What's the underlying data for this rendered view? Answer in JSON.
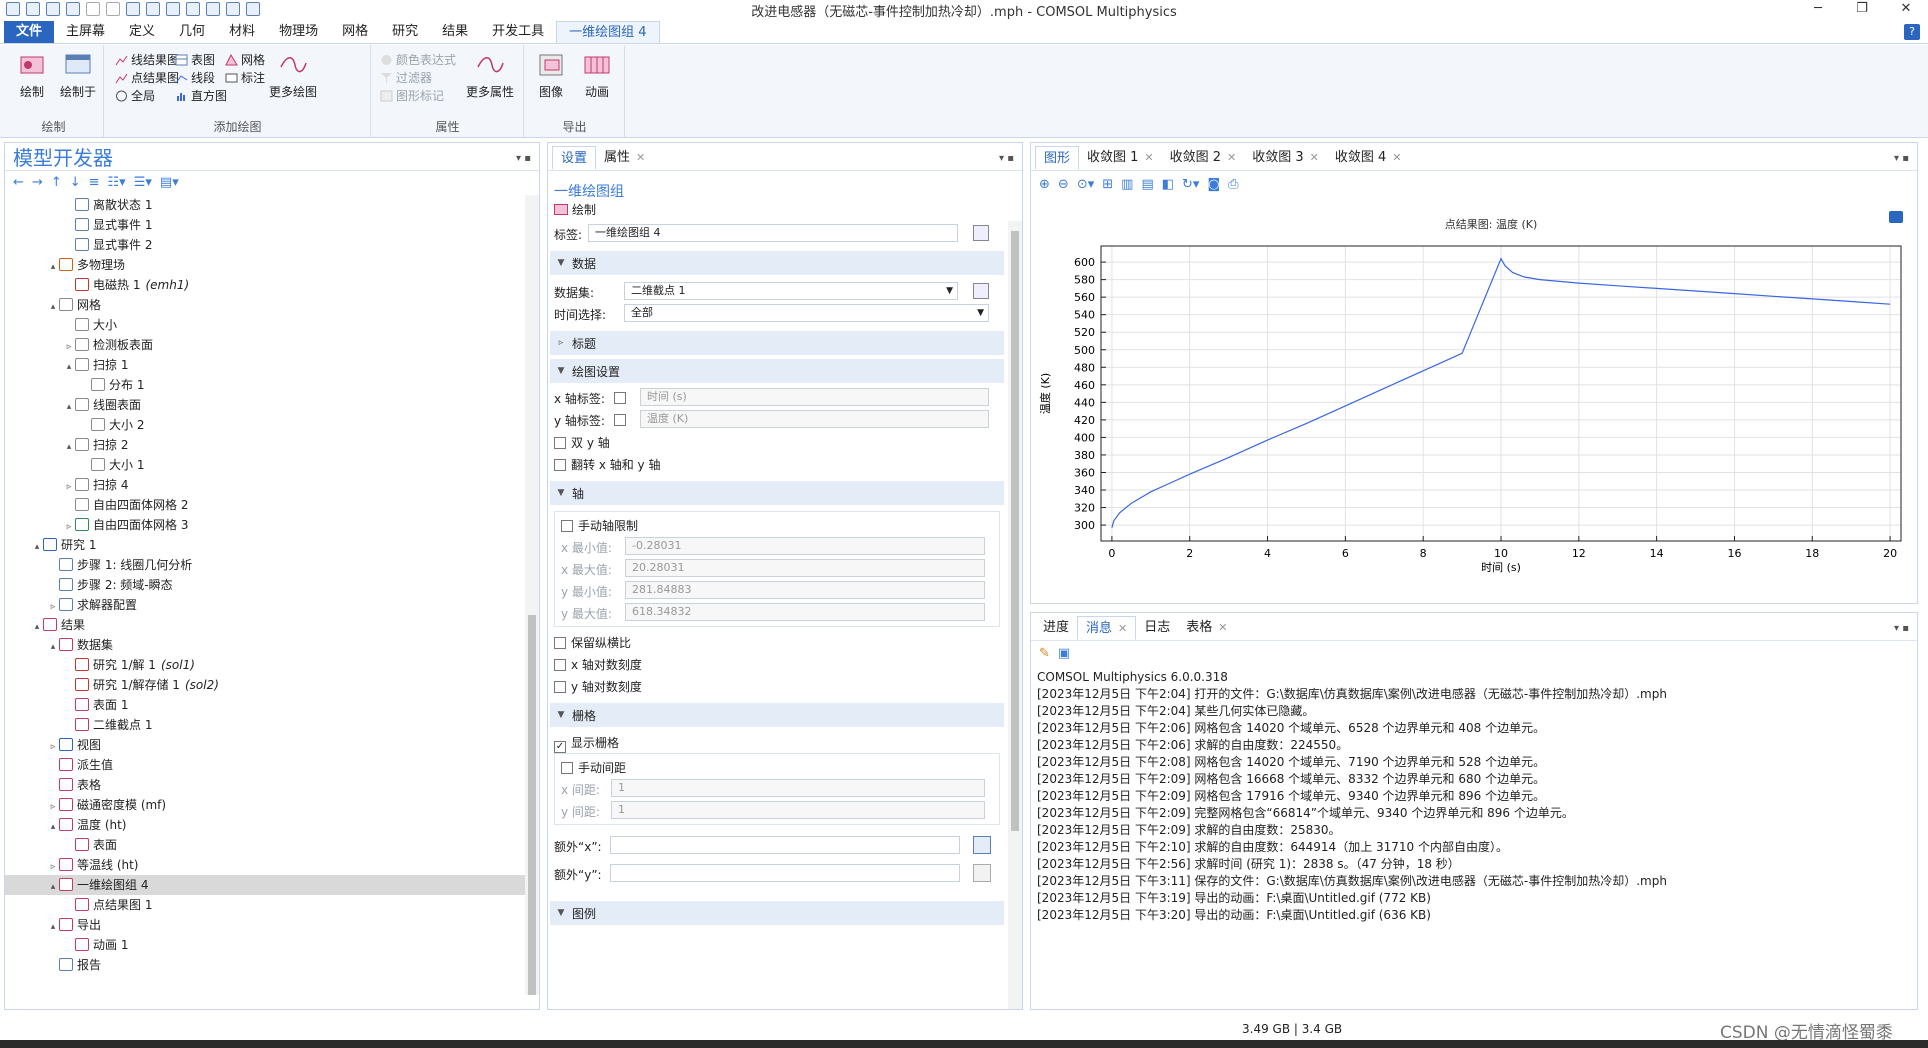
{
  "window": {
    "title": "改进电感器（无磁芯-事件控制加热冷却）.mph - COMSOL Multiphysics",
    "min": "─",
    "max": "❐",
    "close": "✕"
  },
  "menus": [
    "文件",
    "主屏幕",
    "定义",
    "几何",
    "材料",
    "物理场",
    "网格",
    "研究",
    "结果",
    "开发工具",
    "一维绘图组 4"
  ],
  "help": "?",
  "ribbon": {
    "plot_group": {
      "name": "绘制",
      "plot": "绘制",
      "plot_in": "绘制于"
    },
    "add_plot_group": {
      "name": "添加绘图",
      "items": [
        "线结果图",
        "点结果图",
        "全局",
        "表图",
        "线段",
        "直方图",
        "网格",
        "标注"
      ],
      "more": "更多绘图"
    },
    "attributes_group": {
      "name": "属性",
      "items": [
        "颜色表达式",
        "过滤器",
        "图形标记"
      ],
      "more": "更多属性"
    },
    "export_group": {
      "name": "导出",
      "image": "图像",
      "animation": "动画"
    }
  },
  "model_builder": {
    "title": "模型开发器",
    "tree": [
      {
        "label": "离散状态 1",
        "indent": 4,
        "toggle": "",
        "icon": "blue"
      },
      {
        "label": "显式事件 1",
        "indent": 4,
        "toggle": "",
        "icon": "blue"
      },
      {
        "label": "显式事件 2",
        "indent": 4,
        "toggle": "",
        "icon": "blue"
      },
      {
        "label": "多物理场",
        "indent": 3,
        "toggle": "▴",
        "icon": "multi"
      },
      {
        "label": "电磁热 1",
        "tag": "(emh1)",
        "indent": 4,
        "toggle": "",
        "icon": "red"
      },
      {
        "label": "网格",
        "indent": 3,
        "toggle": "▴",
        "icon": "mesh"
      },
      {
        "label": "大小",
        "indent": 4,
        "toggle": "",
        "icon": "mesh"
      },
      {
        "label": "检测板表面",
        "indent": 4,
        "toggle": "▹",
        "icon": "mesh"
      },
      {
        "label": "扫掠 1",
        "indent": 4,
        "toggle": "▴",
        "icon": "mesh"
      },
      {
        "label": "分布 1",
        "indent": 5,
        "toggle": "",
        "icon": "grid"
      },
      {
        "label": "线圈表面",
        "indent": 4,
        "toggle": "▴",
        "icon": "mesh"
      },
      {
        "label": "大小 2",
        "indent": 5,
        "toggle": "",
        "icon": "mesh"
      },
      {
        "label": "扫掠 2",
        "indent": 4,
        "toggle": "▴",
        "icon": "mesh"
      },
      {
        "label": "大小 1",
        "indent": 5,
        "toggle": "",
        "icon": "mesh"
      },
      {
        "label": "扫掠 4",
        "indent": 4,
        "toggle": "▹",
        "icon": "mesh"
      },
      {
        "label": "自由四面体网格 2",
        "indent": 4,
        "toggle": "",
        "icon": "mesh"
      },
      {
        "label": "自由四面体网格 3",
        "indent": 4,
        "toggle": "▹",
        "icon": "green"
      },
      {
        "label": "研究 1",
        "indent": 2,
        "toggle": "▴",
        "icon": "study"
      },
      {
        "label": "步骤 1: 线圈几何分析",
        "indent": 3,
        "toggle": "",
        "icon": "step"
      },
      {
        "label": "步骤 2: 频域-瞬态",
        "indent": 3,
        "toggle": "",
        "icon": "step"
      },
      {
        "label": "求解器配置",
        "indent": 3,
        "toggle": "▹",
        "icon": "solver"
      },
      {
        "label": "结果",
        "indent": 2,
        "toggle": "▴",
        "icon": "results"
      },
      {
        "label": "数据集",
        "indent": 3,
        "toggle": "▴",
        "icon": "dataset"
      },
      {
        "label": "研究 1/解 1",
        "tag": "(sol1)",
        "indent": 4,
        "toggle": "",
        "icon": "red"
      },
      {
        "label": "研究 1/解存储 1",
        "tag": "(sol2)",
        "indent": 4,
        "toggle": "",
        "icon": "red"
      },
      {
        "label": "表面 1",
        "indent": 4,
        "toggle": "",
        "icon": "pink"
      },
      {
        "label": "二维截点 1",
        "indent": 4,
        "toggle": "",
        "icon": "pink"
      },
      {
        "label": "视图",
        "indent": 3,
        "toggle": "▹",
        "icon": "view"
      },
      {
        "label": "派生值",
        "indent": 3,
        "toggle": "",
        "icon": "derived"
      },
      {
        "label": "表格",
        "indent": 3,
        "toggle": "",
        "icon": "table"
      },
      {
        "label": "磁通密度模 (mf)",
        "indent": 3,
        "toggle": "▹",
        "icon": "plot"
      },
      {
        "label": "温度 (ht)",
        "indent": 3,
        "toggle": "▴",
        "icon": "plot"
      },
      {
        "label": "表面",
        "indent": 4,
        "toggle": "",
        "icon": "pink"
      },
      {
        "label": "等温线 (ht)",
        "indent": 3,
        "toggle": "▹",
        "icon": "plot"
      },
      {
        "label": "一维绘图组 4",
        "indent": 3,
        "toggle": "▴",
        "icon": "line",
        "selected": true
      },
      {
        "label": "点结果图 1",
        "indent": 4,
        "toggle": "",
        "icon": "line"
      },
      {
        "label": "导出",
        "indent": 3,
        "toggle": "▴",
        "icon": "plot"
      },
      {
        "label": "动画 1",
        "indent": 4,
        "toggle": "",
        "icon": "pink"
      },
      {
        "label": "报告",
        "indent": 3,
        "toggle": "",
        "icon": "report"
      }
    ]
  },
  "settings": {
    "tabs": [
      "设置",
      "属性"
    ],
    "node_title": "一维绘图组",
    "plot_btn": "绘制",
    "label_caption": "标签:",
    "label_value": "一维绘图组 4",
    "sections": {
      "data": "数据",
      "title": "标题",
      "plot_settings": "绘图设置",
      "axis": "轴",
      "grid": "栅格",
      "legend": "图例"
    },
    "dataset_caption": "数据集:",
    "dataset_value": "二维截点 1",
    "time_caption": "时间选择:",
    "time_value": "全部",
    "xlabel_caption": "x 轴标签:",
    "xlabel_value": "时间 (s)",
    "ylabel_caption": "y 轴标签:",
    "ylabel_value": "温度 (K)",
    "two_y": "双 y 轴",
    "flip": "翻转 x 轴和 y 轴",
    "manual_limits": "手动轴限制",
    "xmin_caption": "x 最小值:",
    "xmin": "-0.28031",
    "xmax_caption": "x 最大值:",
    "xmax": "20.28031",
    "ymin_caption": "y 最小值:",
    "ymin": "281.84883",
    "ymax_caption": "y 最大值:",
    "ymax": "618.34832",
    "keep_aspect": "保留纵横比",
    "xlog": "x 轴对数刻度",
    "ylog": "y 轴对数刻度",
    "show_grid": "显示栅格",
    "manual_spacing": "手动间距",
    "xspace_caption": "x 间距:",
    "xspace": "1",
    "yspace_caption": "y 间距:",
    "yspace": "1",
    "extra_x": "额外“x”:",
    "extra_y": "额外“y”:"
  },
  "graphics": {
    "tabs": [
      "图形",
      "收敛图 1",
      "收敛图 2",
      "收敛图 3",
      "收敛图 4"
    ]
  },
  "chart_data": {
    "type": "line",
    "title": "点结果图: 温度 (K)",
    "xlabel": "时间 (s)",
    "ylabel": "温度 (K)",
    "xlim": [
      -0.28031,
      20.28031
    ],
    "ylim": [
      281.84883,
      618.34832
    ],
    "xticks": [
      0,
      2,
      4,
      6,
      8,
      10,
      12,
      14,
      16,
      18,
      20
    ],
    "yticks": [
      300,
      320,
      340,
      360,
      380,
      400,
      420,
      440,
      460,
      480,
      500,
      520,
      540,
      560,
      580,
      600
    ],
    "grid": true,
    "series": [
      {
        "color": "#3a66e0",
        "x": [
          0,
          0.05,
          0.2,
          0.5,
          1,
          1.5,
          2,
          3,
          4,
          5,
          6,
          7,
          8,
          9,
          10,
          10.1,
          10.3,
          10.6,
          11,
          12,
          13,
          14,
          15,
          16,
          17,
          18,
          19,
          20
        ],
        "y": [
          297,
          305,
          314,
          325,
          338,
          348,
          358,
          377,
          397,
          416,
          436,
          456,
          476,
          496,
          604,
          596,
          588,
          583,
          580,
          576,
          573,
          570,
          567,
          564,
          561,
          558,
          555,
          552
        ]
      }
    ]
  },
  "messages": {
    "tabs": [
      "进度",
      "消息",
      "日志",
      "表格"
    ],
    "lines": [
      "COMSOL Multiphysics 6.0.0.318",
      "[2023年12月5日 下午2:04] 打开的文件：G:\\数据库\\仿真数据库\\案例\\改进电感器（无磁芯-事件控制加热冷却）.mph",
      "[2023年12月5日 下午2:04] 某些几何实体已隐藏。",
      "[2023年12月5日 下午2:06] 网格包含 14020 个域单元、6528 个边界单元和 408 个边单元。",
      "[2023年12月5日 下午2:06] 求解的自由度数：224550。",
      "[2023年12月5日 下午2:08] 网格包含 14020 个域单元、7190 个边界单元和 528 个边单元。",
      "[2023年12月5日 下午2:09] 网格包含 16668 个域单元、8332 个边界单元和 680 个边单元。",
      "[2023年12月5日 下午2:09] 网格包含 17916 个域单元、9340 个边界单元和 896 个边单元。",
      "[2023年12月5日 下午2:09] 完整网格包含“66814”个域单元、9340 个边界单元和 896 个边单元。",
      "[2023年12月5日 下午2:09] 求解的自由度数：25830。",
      "[2023年12月5日 下午2:10] 求解的自由度数：644914（加上 31710 个内部自由度）。",
      "[2023年12月5日 下午2:56] 求解时间 (研究 1)：2838 s。（47 分钟，18 秒）",
      "[2023年12月5日 下午3:11] 保存的文件：G:\\数据库\\仿真数据库\\案例\\改进电感器（无磁芯-事件控制加热冷却）.mph",
      "[2023年12月5日 下午3:19] 导出的动画：F:\\桌面\\Untitled.gif (772 KB)",
      "[2023年12月5日 下午3:20] 导出的动画：F:\\桌面\\Untitled.gif (636 KB)"
    ]
  },
  "status": {
    "memory": "3.49 GB | 3.4 GB",
    "watermark": "CSDN @无情滴怪蜀黍"
  }
}
